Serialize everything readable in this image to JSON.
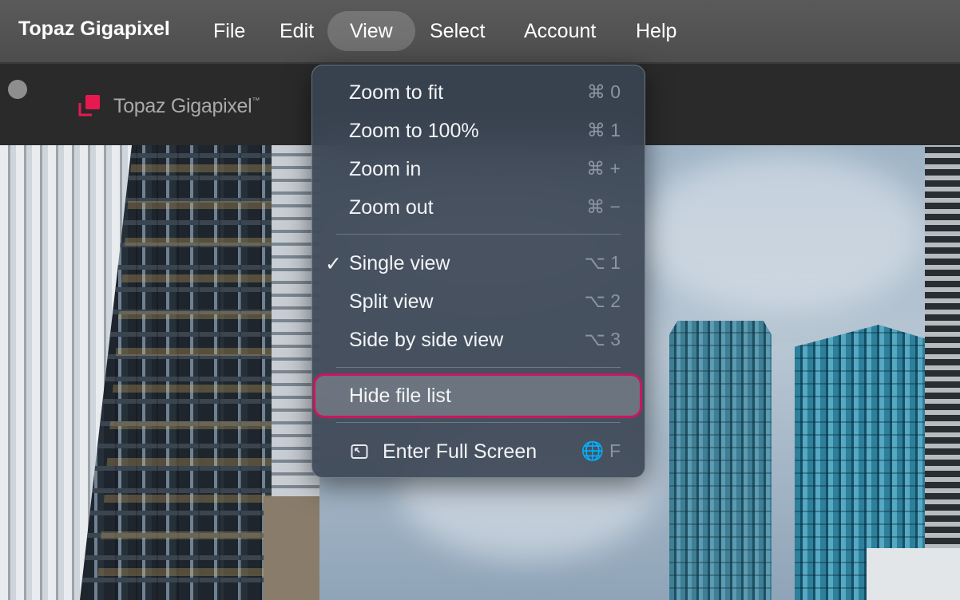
{
  "menubar": {
    "app_name": "Topaz Gigapixel",
    "items": [
      {
        "label": "File"
      },
      {
        "label": "Edit"
      },
      {
        "label": "View",
        "active": true
      },
      {
        "label": "Select"
      },
      {
        "label": "Account"
      },
      {
        "label": "Help"
      }
    ]
  },
  "titlebar": {
    "logo_text": "Topaz Gigapixel",
    "trademark": "™",
    "logo_color": "#e8194f"
  },
  "view_menu": {
    "items": [
      {
        "label": "Zoom to fit",
        "shortcut": "⌘ 0"
      },
      {
        "label": "Zoom to 100%",
        "shortcut": "⌘ 1"
      },
      {
        "label": "Zoom in",
        "shortcut": "⌘ +"
      },
      {
        "label": "Zoom out",
        "shortcut": "⌘ −"
      },
      {
        "label": "Single view",
        "shortcut": "⌥ 1",
        "checked": true,
        "check_glyph": "✓"
      },
      {
        "label": "Split view",
        "shortcut": "⌥ 2"
      },
      {
        "label": "Side by side view",
        "shortcut": "⌥ 3"
      },
      {
        "label": "Hide file list",
        "highlighted": true
      },
      {
        "label": "Enter Full Screen",
        "shortcut": "🌐 F",
        "icon": "fullscreen-icon"
      }
    ],
    "highlight_color": "#c9175e"
  }
}
